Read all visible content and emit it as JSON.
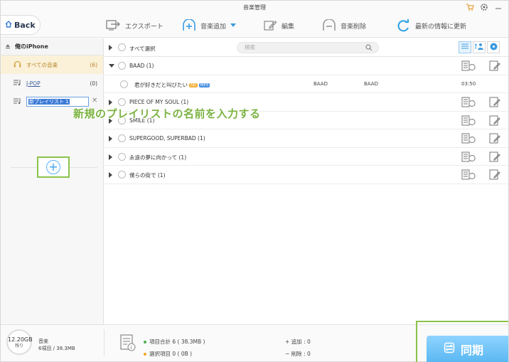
{
  "window": {
    "title": "音楽管理"
  },
  "toolbar": {
    "back_label": "Back",
    "export_label": "エクスポート",
    "add_music_label": "音楽追加",
    "edit_label": "編集",
    "delete_label": "音楽削除",
    "refresh_label": "最新の情報に更新"
  },
  "sidebar": {
    "device_name": "俺のiPhone",
    "items": [
      {
        "label": "すべての音楽",
        "count": "(6)"
      },
      {
        "label": "J-POP",
        "count": "(0)"
      }
    ],
    "new_playlist_value": "新プレイリスト 1"
  },
  "list": {
    "select_all_label": "すべて選択",
    "search_placeholder": "検索",
    "groups": [
      {
        "title": "BAAD (1)"
      },
      {
        "title": "PIECE OF MY SOUL (1)"
      },
      {
        "title": "SMILE (1)"
      },
      {
        "title": "SUPERGOOD, SUPERBAD (1)"
      },
      {
        "title": "永遠の夢に向かって (1)"
      },
      {
        "title": "僕らの街で (1)"
      }
    ],
    "song": {
      "title": "君が好きだと叫びたい",
      "badge1": "SD",
      "badge2": "MP3",
      "artist": "BAAD",
      "album": "BAAD",
      "duration": "03:50"
    }
  },
  "annotation": {
    "text": "新規のプレイリストの名前を入力する"
  },
  "footer": {
    "storage_gb": "12.20GB",
    "storage_remaining": "残り",
    "storage_type": "音楽",
    "storage_detail": "6項目 / 38.3MB",
    "total_items": "項目合計 6 ( 38.3MB )",
    "selected_items": "選択項目 0 ( 0B )",
    "added": "追加 : 0",
    "deleted": "削除 : 0",
    "sync_label": "同期"
  },
  "colors": {
    "accent_green": "#8bc34a",
    "accent_blue": "#3aa0f0",
    "active_orange": "#b8862a",
    "dot_green": "#4caf50",
    "dot_orange": "#f5a623"
  }
}
